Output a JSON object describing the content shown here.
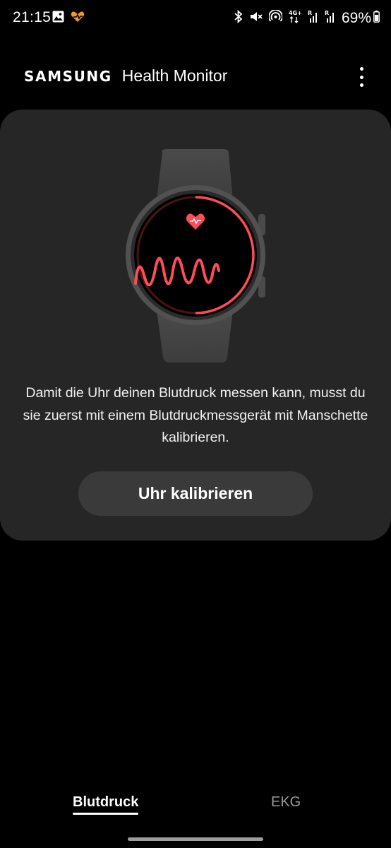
{
  "status_bar": {
    "time": "21:15",
    "battery": "69%",
    "left_icons": [
      "gallery-icon",
      "health-heart-icon"
    ],
    "right_icons": [
      "bluetooth-icon",
      "mute-icon",
      "hotspot-icon",
      "signal-4g-icon",
      "signal-r1-icon",
      "signal-r2-icon",
      "battery-icon"
    ]
  },
  "header": {
    "brand": "SAMSUNG",
    "title": "Health Monitor"
  },
  "card": {
    "description": "Damit die Uhr deinen Blutdruck messen kann, musst du sie zuerst mit einem Blutdruckmessgerät mit Manschette kalibrieren.",
    "button_label": "Uhr kalibrieren"
  },
  "tabs": [
    {
      "label": "Blutdruck",
      "selected": true
    },
    {
      "label": "EKG",
      "selected": false
    }
  ],
  "colors": {
    "accent_red": "#ff4d57",
    "card_bg": "#262626",
    "button_bg": "#3a3a3a",
    "inactive_tab": "#9a9a9a"
  }
}
